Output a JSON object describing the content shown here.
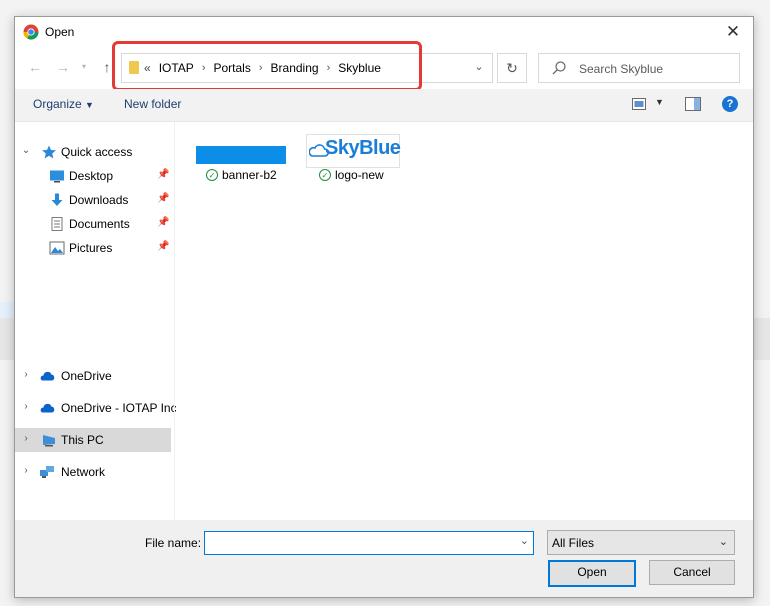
{
  "window": {
    "title": "Open"
  },
  "address": {
    "overflow": "«",
    "crumbs": [
      "IOTAP",
      "Portals",
      "Branding",
      "Skyblue"
    ]
  },
  "search": {
    "placeholder": "Search Skyblue"
  },
  "toolbar": {
    "organize": "Organize",
    "new_folder": "New folder"
  },
  "sidebar": {
    "items": [
      {
        "label": "Quick access",
        "icon": "star-icon"
      },
      {
        "label": "Desktop",
        "icon": "desktop-icon"
      },
      {
        "label": "Downloads",
        "icon": "download-icon"
      },
      {
        "label": "Documents",
        "icon": "documents-icon"
      },
      {
        "label": "Pictures",
        "icon": "pictures-icon"
      },
      {
        "label": "OneDrive",
        "icon": "cloud-icon"
      },
      {
        "label": "OneDrive - IOTAP Inc",
        "icon": "cloud-icon"
      },
      {
        "label": "This PC",
        "icon": "computer-icon"
      },
      {
        "label": "Network",
        "icon": "network-icon"
      }
    ]
  },
  "files": [
    {
      "name": "banner-b2",
      "status": "synced"
    },
    {
      "name": "logo-new",
      "status": "synced"
    }
  ],
  "logo": {
    "text": "SkyBlue"
  },
  "footer": {
    "file_name_label": "File name:",
    "file_name_value": "",
    "file_type": "All Files",
    "open": "Open",
    "cancel": "Cancel"
  },
  "colors": {
    "accent": "#0078d7",
    "highlight": "#e53935",
    "banner": "#0c8ee8"
  }
}
